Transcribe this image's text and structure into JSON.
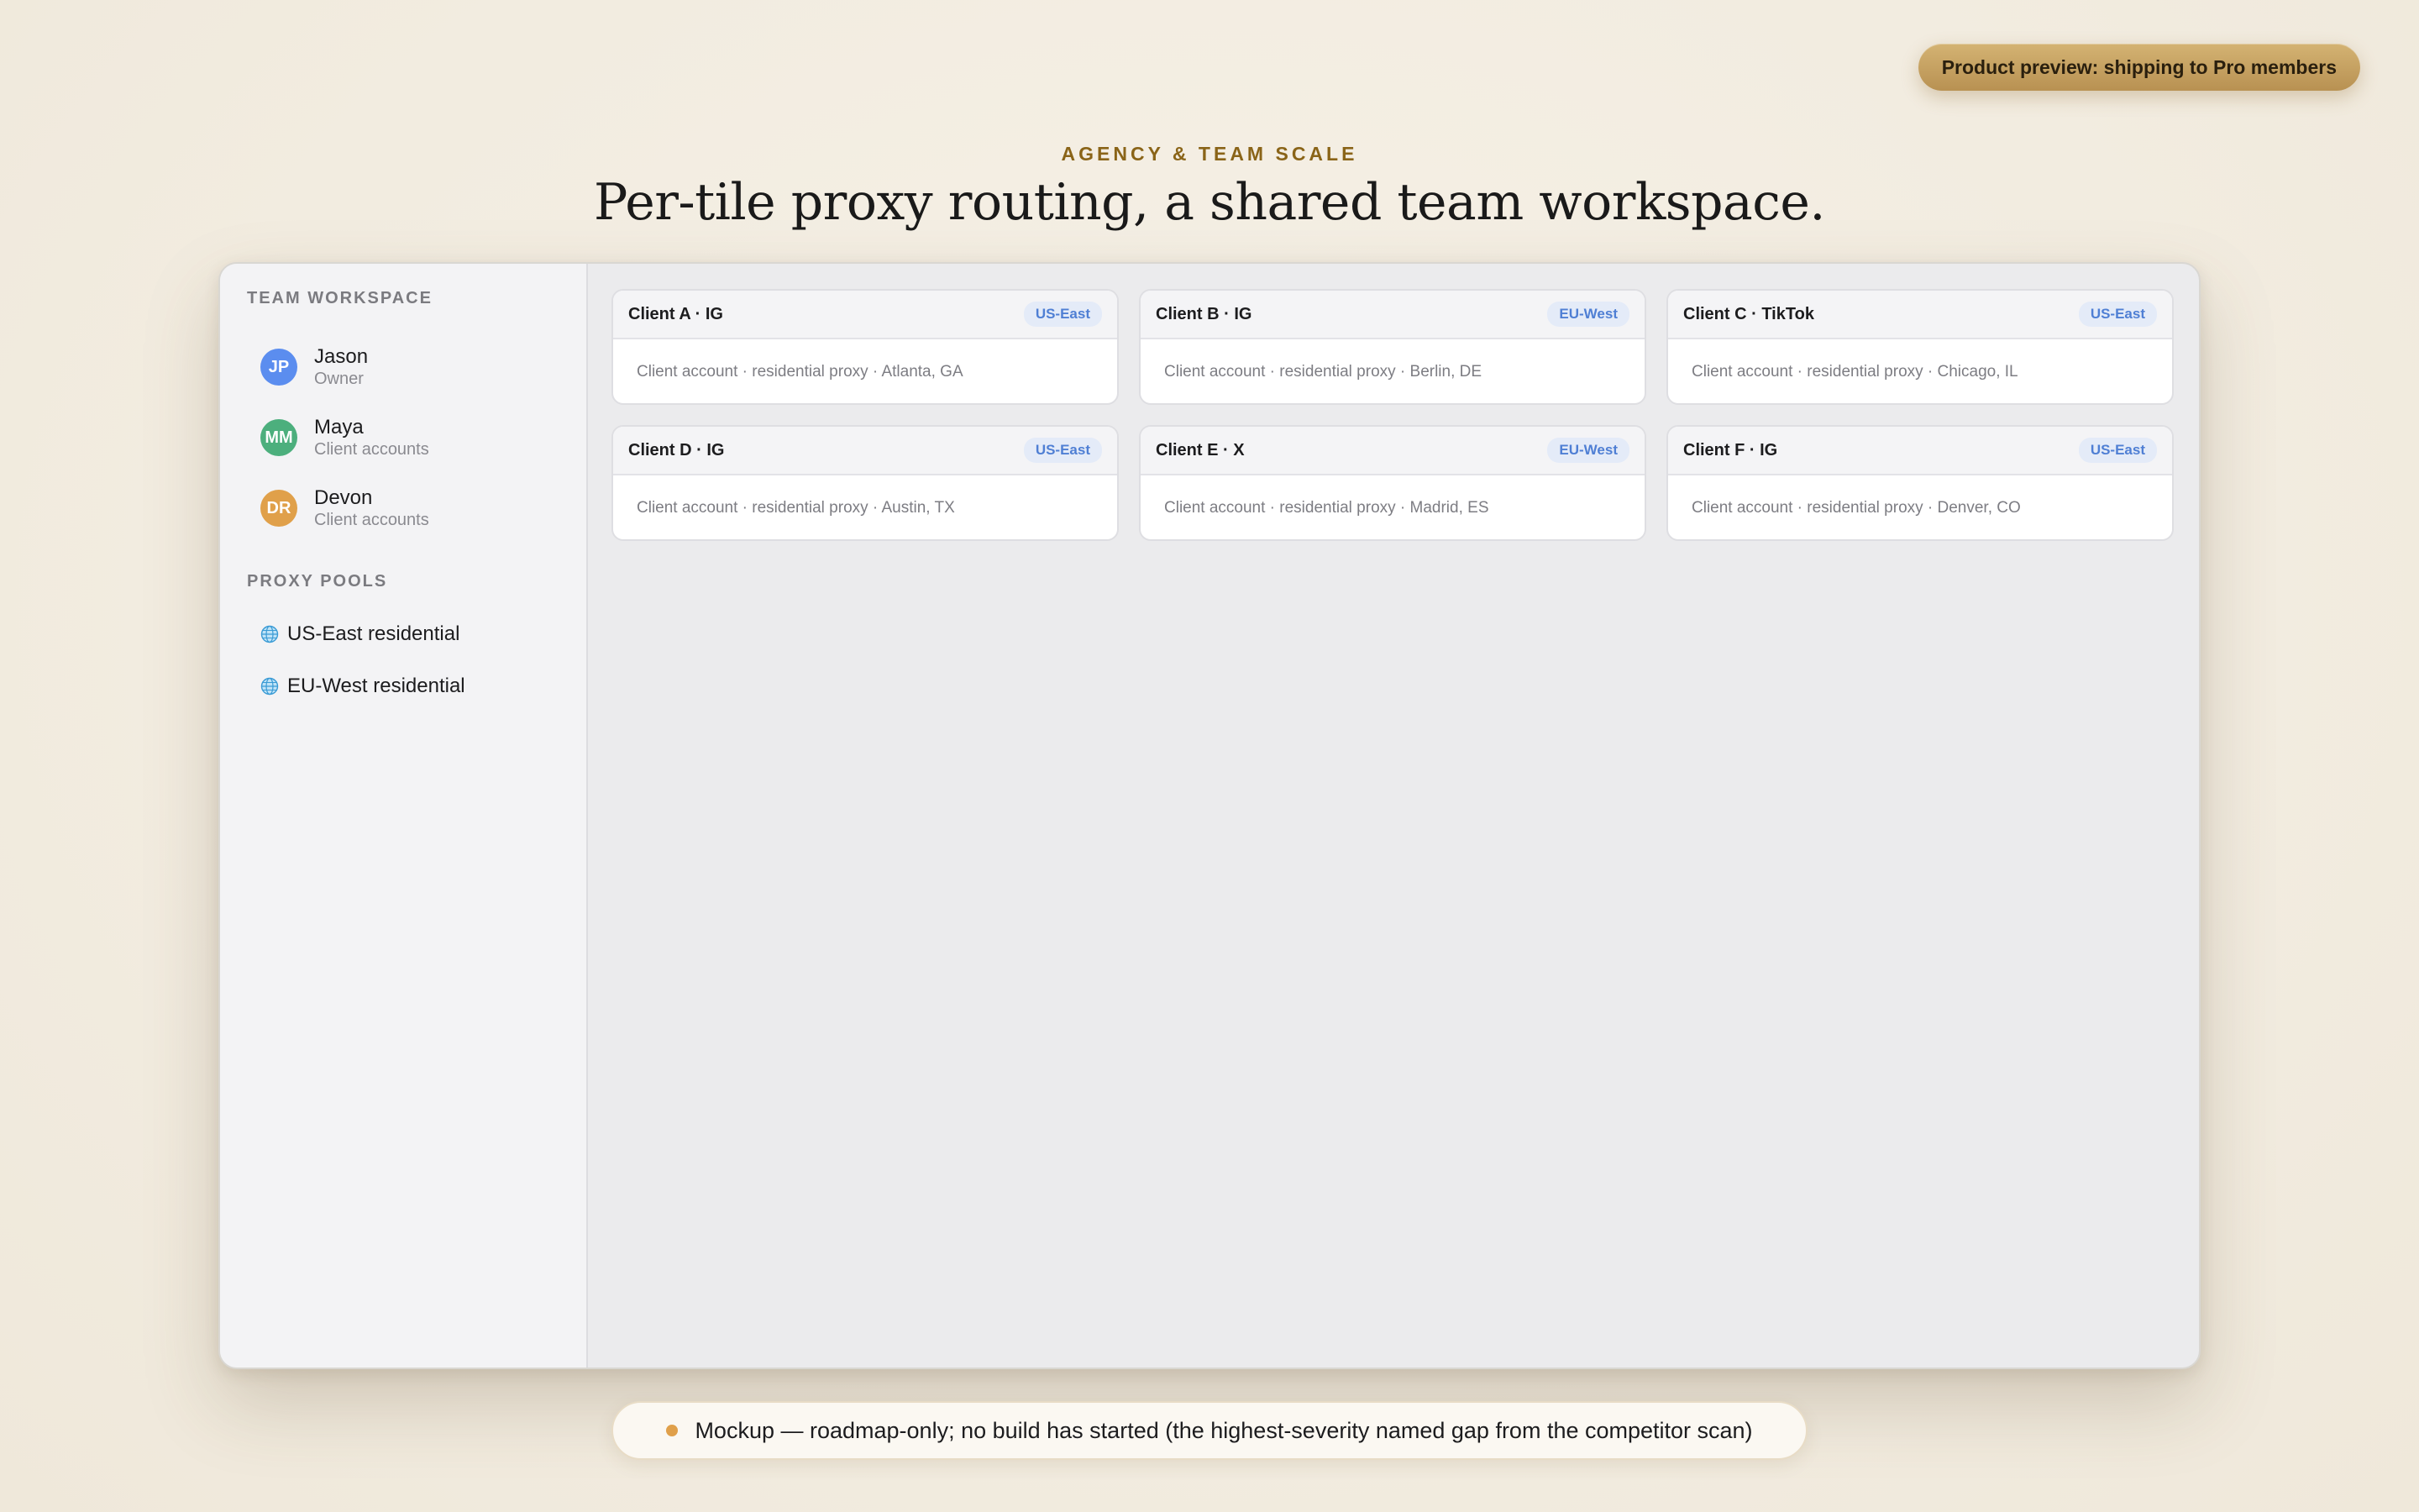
{
  "preview_badge": "Product preview: shipping to Pro members",
  "eyebrow": "AGENCY & TEAM SCALE",
  "headline": "Per-tile proxy routing, a shared team workspace.",
  "sidebar": {
    "team_heading": "TEAM WORKSPACE",
    "members": [
      {
        "initials": "JP",
        "name": "Jason",
        "role": "Owner",
        "color": "#5b8def"
      },
      {
        "initials": "MM",
        "name": "Maya",
        "role": "Client accounts",
        "color": "#4caf7d"
      },
      {
        "initials": "DR",
        "name": "Devon",
        "role": "Client accounts",
        "color": "#e0a04a"
      }
    ],
    "pools_heading": "PROXY POOLS",
    "pools": [
      {
        "icon": "globe-icon",
        "label": "US-East residential"
      },
      {
        "icon": "globe-icon",
        "label": "EU-West residential"
      }
    ]
  },
  "tiles": [
    {
      "title": "Client A · IG",
      "region": "US-East",
      "detail": "Client account · residential proxy · Atlanta, GA"
    },
    {
      "title": "Client B · IG",
      "region": "EU-West",
      "detail": "Client account · residential proxy · Berlin, DE"
    },
    {
      "title": "Client C · TikTok",
      "region": "US-East",
      "detail": "Client account · residential proxy · Chicago, IL"
    },
    {
      "title": "Client D · IG",
      "region": "US-East",
      "detail": "Client account · residential proxy · Austin, TX"
    },
    {
      "title": "Client E · X",
      "region": "EU-West",
      "detail": "Client account · residential proxy · Madrid, ES"
    },
    {
      "title": "Client F · IG",
      "region": "US-East",
      "detail": "Client account · residential proxy · Denver, CO"
    }
  ],
  "footer_note": "Mockup — roadmap-only; no build has started (the highest-severity named gap from the competitor scan)",
  "colors": {
    "accent_gold": "#8a6418",
    "badge_blue": "#4f7fd4",
    "status_dot": "#e0a04a"
  }
}
